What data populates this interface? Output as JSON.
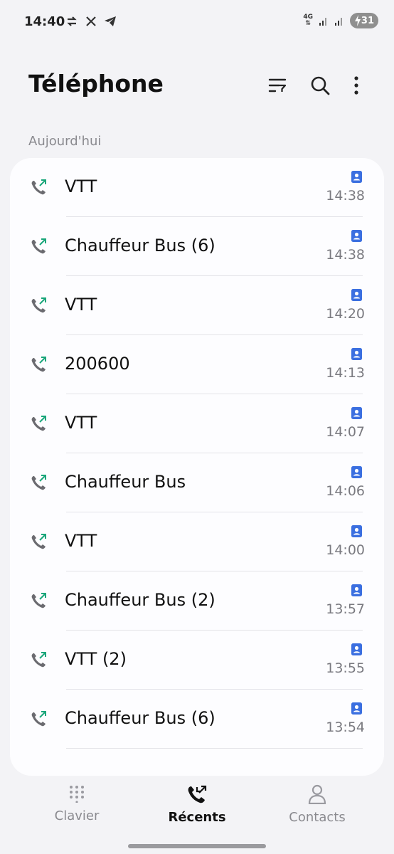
{
  "status_bar": {
    "time": "14:40",
    "network": "4G",
    "battery": "31",
    "icons": [
      "sync-icon",
      "x-logo-icon",
      "telegram-icon"
    ]
  },
  "header": {
    "title": "Téléphone",
    "actions": [
      "filter-icon",
      "search-icon",
      "more-icon"
    ]
  },
  "section": {
    "label": "Aujourd'hui"
  },
  "colors": {
    "accent": "#3b6fe0",
    "call_arrow": "#1aa67a"
  },
  "calls": [
    {
      "name": "VTT",
      "time": "14:38"
    },
    {
      "name": "Chauffeur Bus (6)",
      "time": "14:38"
    },
    {
      "name": "VTT",
      "time": "14:20"
    },
    {
      "name": "200600",
      "time": "14:13"
    },
    {
      "name": "VTT",
      "time": "14:07"
    },
    {
      "name": "Chauffeur Bus",
      "time": "14:06"
    },
    {
      "name": "VTT",
      "time": "14:00"
    },
    {
      "name": "Chauffeur Bus (2)",
      "time": "13:57"
    },
    {
      "name": "VTT (2)",
      "time": "13:55"
    },
    {
      "name": "Chauffeur Bus (6)",
      "time": "13:54"
    }
  ],
  "bottom_nav": {
    "items": [
      {
        "label": "Clavier",
        "icon": "dialpad-icon"
      },
      {
        "label": "Récents",
        "icon": "recent-calls-icon",
        "active": true
      },
      {
        "label": "Contacts",
        "icon": "contacts-icon"
      }
    ]
  }
}
